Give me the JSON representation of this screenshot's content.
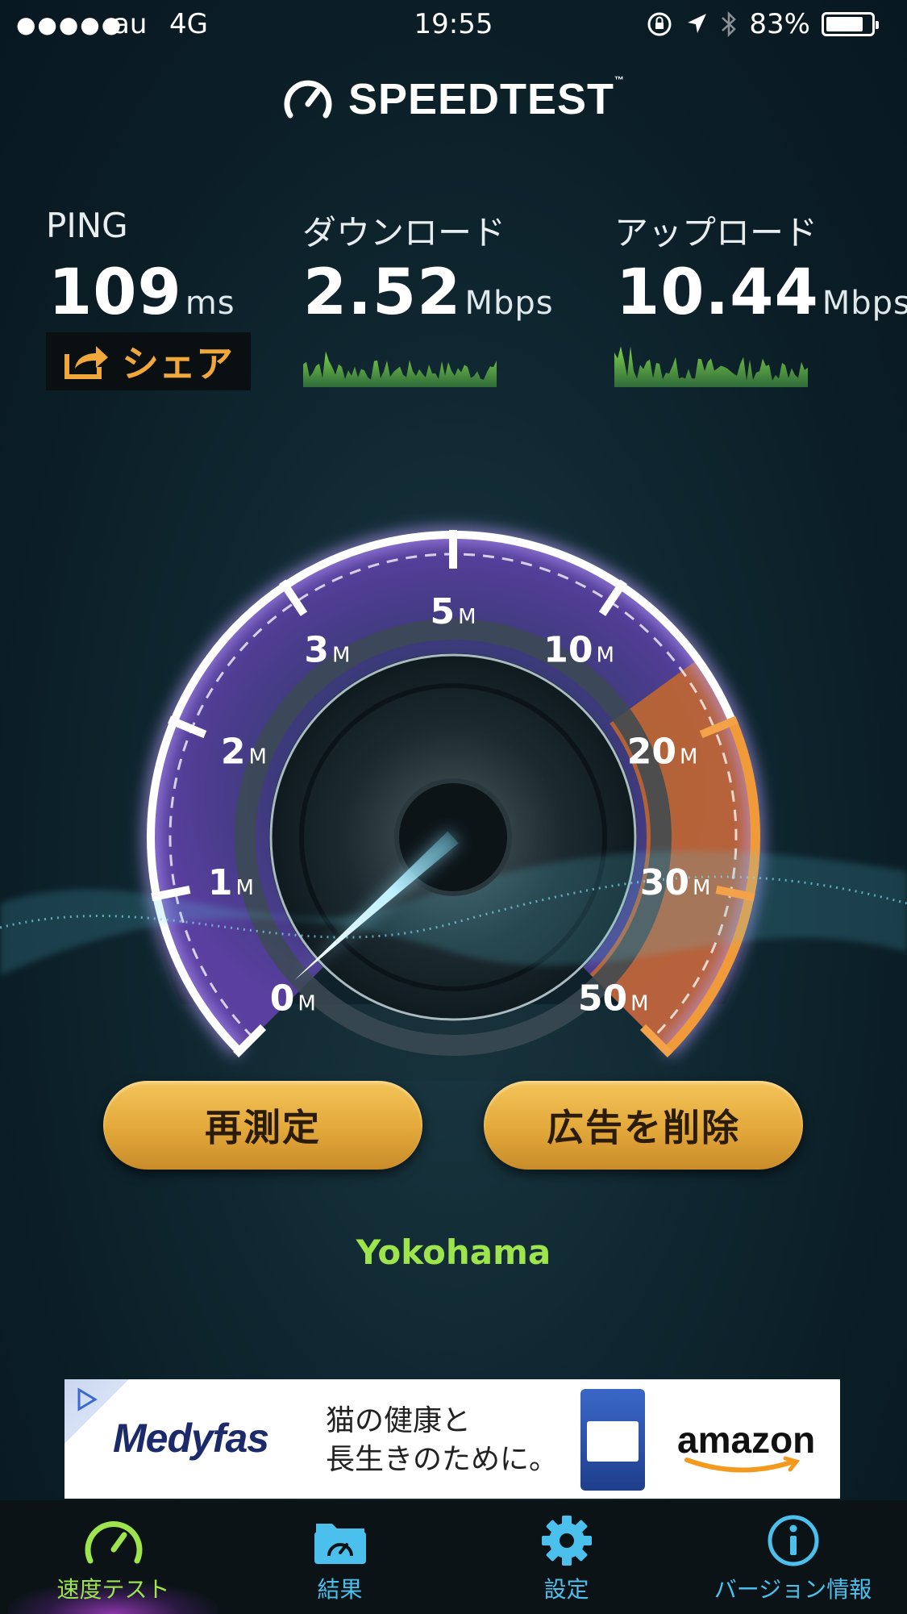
{
  "status_bar": {
    "signal_dots": "●●●●●",
    "carrier": "au",
    "network": "4G",
    "time": "19:55",
    "battery_percent": "83%",
    "battery_level": 0.83
  },
  "header": {
    "brand": "SPEEDTEST",
    "trademark": "™"
  },
  "metrics": {
    "ping": {
      "label": "PING",
      "value": "109",
      "unit": "ms"
    },
    "download": {
      "label": "ダウンロード",
      "value": "2.52",
      "unit": "Mbps"
    },
    "upload": {
      "label": "アップロード",
      "value": "10.44",
      "unit": "Mbps"
    },
    "share_label": "シェア"
  },
  "gauge": {
    "ticks": [
      {
        "num": "0",
        "unit": "M"
      },
      {
        "num": "1",
        "unit": "M"
      },
      {
        "num": "2",
        "unit": "M"
      },
      {
        "num": "3",
        "unit": "M"
      },
      {
        "num": "5",
        "unit": "M"
      },
      {
        "num": "10",
        "unit": "M"
      },
      {
        "num": "20",
        "unit": "M"
      },
      {
        "num": "30",
        "unit": "M"
      },
      {
        "num": "50",
        "unit": "M"
      }
    ]
  },
  "actions": {
    "retest": "再測定",
    "remove_ads": "広告を削除"
  },
  "location": "Yokohama",
  "ad": {
    "logo": "Medyfas",
    "line1": "猫の健康と",
    "line2": "長生きのために。",
    "merchant": "amazon"
  },
  "tabs": [
    {
      "label": "速度テスト",
      "icon": "speedometer-icon",
      "active": true
    },
    {
      "label": "結果",
      "icon": "results-folder-icon",
      "active": false
    },
    {
      "label": "設定",
      "icon": "gear-icon",
      "active": false
    },
    {
      "label": "バージョン情報",
      "icon": "info-icon",
      "active": false
    }
  ],
  "colors": {
    "accent_green": "#9ee44c",
    "tab_blue": "#4cc0ec",
    "button_gold": "#e3a83a",
    "share_orange": "#f0a83a",
    "gauge_purple": "#5a3fa0",
    "gauge_orange": "#e0782a"
  }
}
